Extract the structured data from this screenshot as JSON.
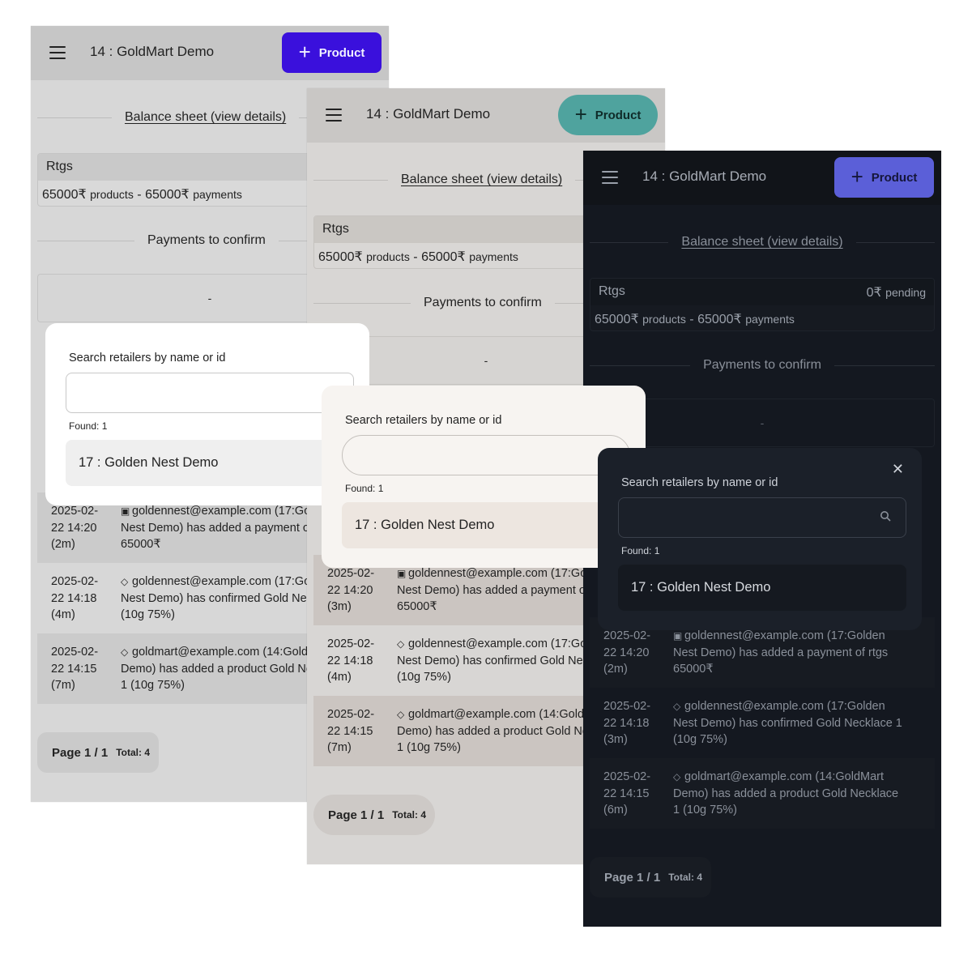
{
  "app": {
    "title": "14 : GoldMart Demo",
    "product_button": "Product",
    "balance_link": "Balance sheet (view details)",
    "payments_header": "Payments to confirm",
    "payments_empty": "-"
  },
  "rtgs": {
    "name": "Rtgs",
    "pending_amount": "0₹",
    "pending_label": "pending",
    "products_amount": "65000₹",
    "products_label": "products",
    "separator": "-",
    "payments_amount": "65000₹",
    "payments_label": "payments"
  },
  "search_modal": {
    "label": "Search retailers by name or id",
    "input_value": "",
    "found": "Found: 1",
    "result": "17 : Golden Nest Demo"
  },
  "feed": {
    "rows": [
      {
        "date": "2025-02-\n22 14:20",
        "message": "goldennest@example.com (17:Golden\nNest Demo) has added a payment of rtgs\n65000₹",
        "icon": "money-icon"
      },
      {
        "date": "2025-02-\n22 14:18",
        "message": "goldennest@example.com (17:Golden\nNest Demo) has confirmed Gold Necklace 1\n(10g 75%)",
        "icon": "tag-icon"
      },
      {
        "date": "2025-02-\n22 14:15",
        "message": "goldmart@example.com (14:GoldMart\nDemo) has added a product Gold Necklace\n1 (10g 75%)",
        "icon": "tag-icon"
      }
    ],
    "ages": {
      "screen1": [
        "(2m)",
        "(4m)",
        "(7m)"
      ],
      "screen2": [
        "(3m)",
        "(4m)",
        "(7m)"
      ],
      "screen3": [
        "(2m)",
        "(3m)",
        "(6m)"
      ]
    }
  },
  "pager": {
    "page": "Page 1 / 1",
    "total": "Total: 4"
  },
  "themes": {
    "screen1_accent": "#3a10dc",
    "screen2_accent": "#4fa39e",
    "screen3_accent": "#5b5fd8"
  }
}
